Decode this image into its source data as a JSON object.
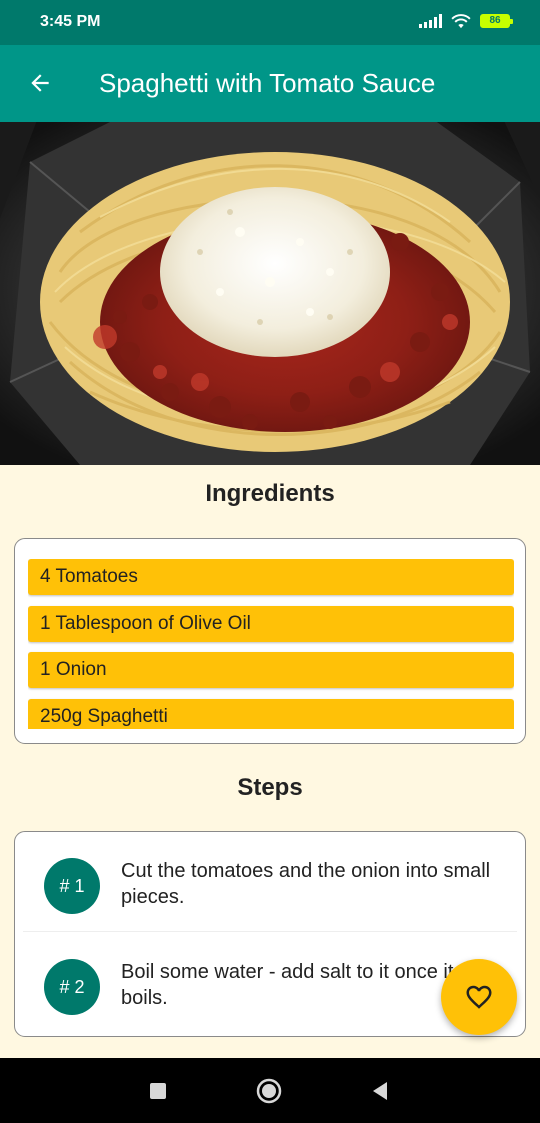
{
  "status_bar": {
    "time": "3:45 PM",
    "battery_level": "86",
    "icons": [
      "signal-icon",
      "wifi-icon",
      "battery-icon"
    ]
  },
  "app_bar": {
    "title": "Spaghetti with Tomato Sauce",
    "back_icon": "arrow-left-icon"
  },
  "hero_image": {
    "description": "plate of spaghetti with tomato meat sauce and grated parmesan",
    "icon": "meal-photo"
  },
  "ingredients": {
    "title": "Ingredients",
    "items": [
      "4 Tomatoes",
      "1 Tablespoon of Olive Oil",
      "1 Onion",
      "250g Spaghetti"
    ]
  },
  "steps": {
    "title": "Steps",
    "items": [
      {
        "number": "# 1",
        "text": "Cut the tomatoes and the onion into small pieces."
      },
      {
        "number": "# 2",
        "text": "Boil some water - add salt to it once it boils."
      }
    ]
  },
  "fab": {
    "icon": "heart-outline-icon"
  },
  "nav_bar": {
    "icons": [
      "recents-square-icon",
      "home-circle-icon",
      "back-triangle-icon"
    ]
  },
  "colors": {
    "primary": "#009688",
    "primary_dark": "#00796b",
    "accent": "#ffc107",
    "background": "#fff8e1"
  }
}
